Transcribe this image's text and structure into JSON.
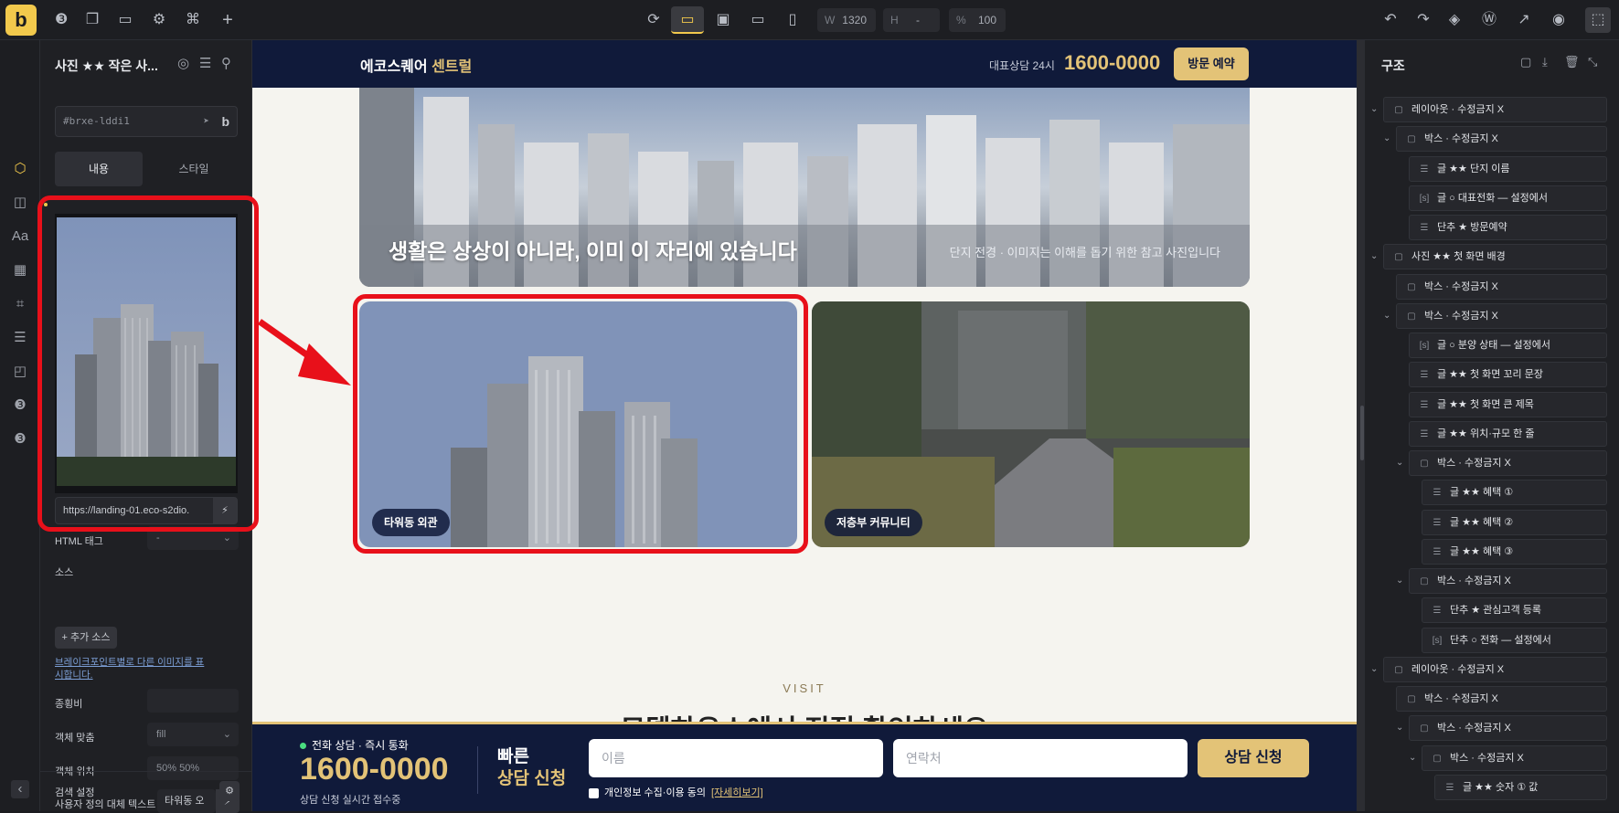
{
  "toolbar": {
    "logo": "b",
    "width_key": "W",
    "width_value": "1320",
    "height_key": "H",
    "height_value": "-",
    "percent_key": "%",
    "percent_value": "100"
  },
  "left_panel": {
    "title": "사진 ★★ 작은 사...",
    "element_id": "#brxe-lddi1",
    "tabs": [
      "내용",
      "스타일"
    ],
    "image_url": "https://landing-01.eco-s2dio.",
    "props": {
      "html_tag_label": "HTML 태그",
      "html_tag_value": "-",
      "source_label": "소스",
      "add_source": "+ 추가 소스",
      "hint": "브레이크포인트별로 다른 이미지를 표시합니다.",
      "aspect_label": "종횡비",
      "aspect_value": "",
      "fit_label": "객체 맞춤",
      "fit_value": "fill",
      "position_label": "객체 위치",
      "position_value": "50% 50%",
      "alt_label": "사용자 정의 대체 텍스트",
      "alt_value": "타워동 오"
    },
    "bottom_label": "검색 설정"
  },
  "site": {
    "brand_main": "에코스퀘어",
    "brand_accent": "센트럴",
    "header_sub": "대표상담 24시",
    "header_phone": "1600-0000",
    "header_button": "방문 예약",
    "hero_title": "생활은 상상이 아니라, 이미 이 자리에 있습니다",
    "hero_caption": "단지 전경 · 이미지는 이해를 돕기 위한 참고 사진입니다",
    "card1_badge": "타워동 외관",
    "card2_badge": "저층부 커뮤니티",
    "visit_label": "VISIT",
    "visit_heading": "모델하우스에서 직접 확인하세요",
    "bottom": {
      "live": "전화 상담 · 즉시 통화",
      "phone": "1600-0000",
      "note": "상담 신청 실시간 접수중",
      "head1": "빠른",
      "head2": "상담 신청",
      "name_placeholder": "이름",
      "contact_placeholder": "연락처",
      "submit": "상담 신청",
      "consent": "개인정보 수집·이용 동의",
      "consent_link": "[자세히보기]"
    }
  },
  "right_panel": {
    "title": "구조",
    "tree": [
      {
        "label": "레이아웃 · 수정금지 X",
        "depth": 0,
        "icon": "box",
        "toggle": true
      },
      {
        "label": "박스 · 수정금지 X",
        "depth": 1,
        "icon": "box",
        "toggle": true
      },
      {
        "label": "글 ★★ 단지 이름",
        "depth": 2,
        "icon": "text",
        "toggle": false
      },
      {
        "label": "글 ○ 대표전화 — 설정에서",
        "depth": 2,
        "icon": "code",
        "toggle": false
      },
      {
        "label": "단추 ★ 방문예약",
        "depth": 2,
        "icon": "text",
        "toggle": false
      },
      {
        "label": "사진 ★★ 첫 화면 배경",
        "depth": 0,
        "icon": "box",
        "toggle": true
      },
      {
        "label": "박스 · 수정금지 X",
        "depth": 1,
        "icon": "box",
        "toggle": false
      },
      {
        "label": "박스 · 수정금지 X",
        "depth": 1,
        "icon": "box",
        "toggle": true
      },
      {
        "label": "글 ○ 분양 상태 — 설정에서",
        "depth": 2,
        "icon": "code",
        "toggle": false
      },
      {
        "label": "글 ★★ 첫 화면 꼬리 문장",
        "depth": 2,
        "icon": "text",
        "toggle": false
      },
      {
        "label": "글 ★★ 첫 화면 큰 제목",
        "depth": 2,
        "icon": "text",
        "toggle": false
      },
      {
        "label": "글 ★★ 위치·규모 한 줄",
        "depth": 2,
        "icon": "text",
        "toggle": false
      },
      {
        "label": "박스 · 수정금지 X",
        "depth": 2,
        "icon": "box",
        "toggle": true
      },
      {
        "label": "글 ★★ 혜택 ①",
        "depth": 3,
        "icon": "text",
        "toggle": false
      },
      {
        "label": "글 ★★ 혜택 ②",
        "depth": 3,
        "icon": "text",
        "toggle": false
      },
      {
        "label": "글 ★★ 혜택 ③",
        "depth": 3,
        "icon": "text",
        "toggle": false
      },
      {
        "label": "박스 · 수정금지 X",
        "depth": 2,
        "icon": "box",
        "toggle": true
      },
      {
        "label": "단추 ★ 관심고객 등록",
        "depth": 3,
        "icon": "text",
        "toggle": false
      },
      {
        "label": "단추 ○ 전화 — 설정에서",
        "depth": 3,
        "icon": "code",
        "toggle": false
      },
      {
        "label": "레이아웃 · 수정금지 X",
        "depth": 0,
        "icon": "box",
        "toggle": true
      },
      {
        "label": "박스 · 수정금지 X",
        "depth": 1,
        "icon": "box",
        "toggle": false
      },
      {
        "label": "박스 · 수정금지 X",
        "depth": 2,
        "icon": "box",
        "toggle": true
      },
      {
        "label": "박스 · 수정금지 X",
        "depth": 3,
        "icon": "box",
        "toggle": true
      },
      {
        "label": "글 ★★ 숫자 ① 값",
        "depth": 4,
        "icon": "text",
        "toggle": false
      }
    ]
  },
  "colors": {
    "accent": "#f2c94c",
    "navy": "#101a3a",
    "gold": "#e3c377",
    "highlight": "#e8101a"
  }
}
